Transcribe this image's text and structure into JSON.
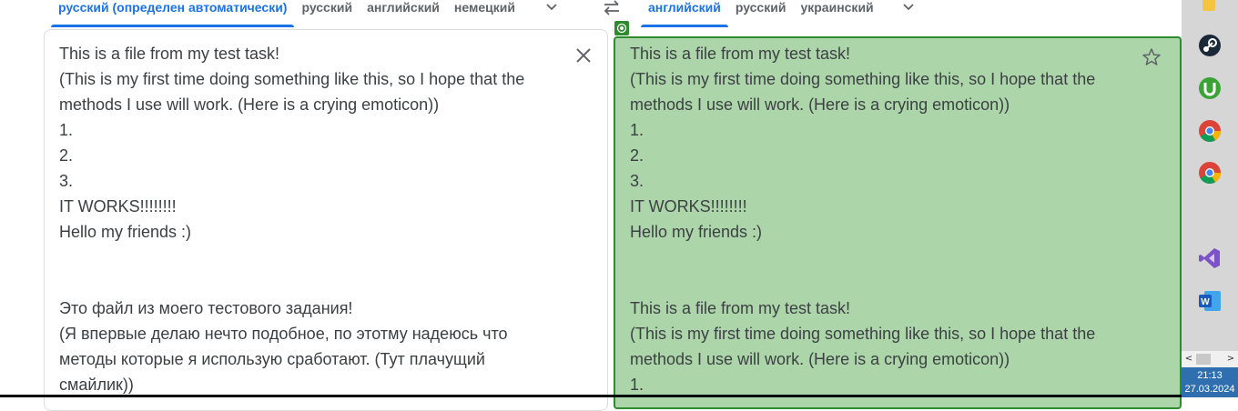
{
  "source_langs": {
    "tabs": [
      "русский (определен автоматически)",
      "русский",
      "английский",
      "немецкий"
    ],
    "active_index": 0
  },
  "target_langs": {
    "tabs": [
      "английский",
      "русский",
      "украинский"
    ],
    "active_index": 0
  },
  "source_text": "This is a file from my test task!\n(This is my first time doing something like this, so I hope that the\nmethods I use will work. (Here is a crying emoticon))\n1.\n2.\n3.\nIT WORKS!!!!!!!!\nHello my friends :)\n\n\nЭто файл из моего тестового задания!\n(Я впервые делаю нечто подобное, по этотму надеюсь что\nметоды которые я использую сработают. (Тут плачущий\nсмайлик))",
  "target_text": "This is a file from my test task!\n(This is my first time doing something like this, so I hope that the\nmethods I use will work. (Here is a crying emoticon))\n1.\n2.\n3.\nIT WORKS!!!!!!!!\nHello my friends :)\n\n\nThis is a file from my test task!\n(This is my first time doing something like this, so I hope that the\nmethods I use will work. (Here is a crying emoticon))\n1.",
  "taskbar": {
    "icons": [
      "folder-icon",
      "steam-icon",
      "utorrent-icon",
      "chrome-icon",
      "chrome-icon",
      "visual-studio-icon",
      "word-icon"
    ],
    "time": "21:13",
    "date": "27.03.2024"
  },
  "colors": {
    "accent": "#1a73e8",
    "highlight_fill": "#acd6a9",
    "highlight_border": "#2e8b2e",
    "taskbar_clock": "#2f6fb0"
  }
}
